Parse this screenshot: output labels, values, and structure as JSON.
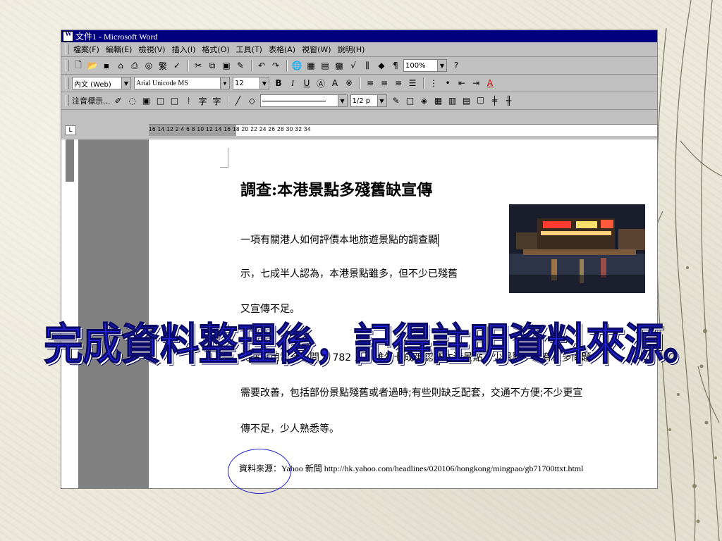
{
  "window": {
    "title": "文件1 - Microsoft Word"
  },
  "menu": [
    "檔案(F)",
    "編輯(E)",
    "檢視(V)",
    "插入(I)",
    "格式(O)",
    "工具(T)",
    "表格(A)",
    "視窗(W)",
    "說明(H)"
  ],
  "toolbar_standard": {
    "zoom": "100%"
  },
  "toolbar_format": {
    "style": "內文 (Web)",
    "font": "Arial Unicode MS",
    "size": "12",
    "traditional_label": "繁"
  },
  "toolbar_phonetic": {
    "label": "注音標示...",
    "line_weight": "1/2 p"
  },
  "ruler_h_marks": "16  14  12   2   4   6   8  10  12  14  16  18  20  22  24  26  28  30  32  34",
  "document": {
    "title": "調查:本港景點多殘舊缺宣傳",
    "lines": [
      "一項有關港人如何評價本地旅遊景點的調查顯",
      "示，七成半人認為，本港景點雖多，但不少已殘舊",
      "又宣傳不足。",
      "民建聯用電話訪問了 782 人，雖然七成半認為本港景點不少景點，但有很多問題",
      "需要改善，包括部份景點殘舊或者過時;有些則缺乏配套，交通不方便;不少更宣",
      "傳不足，少人熟悉等。"
    ],
    "source_label": "資料來源：",
    "source_text": "Yahoo 新聞  http://hk.yahoo.com/headlines/020106/hongkong/mingpao/gb71700ttxt.html"
  },
  "overlay_text": "完成資料整理後，記得註明資料來源。",
  "colors": {
    "title_bar": "#000080",
    "overlay": "#2323e0",
    "ellipse": "#2222cc"
  }
}
